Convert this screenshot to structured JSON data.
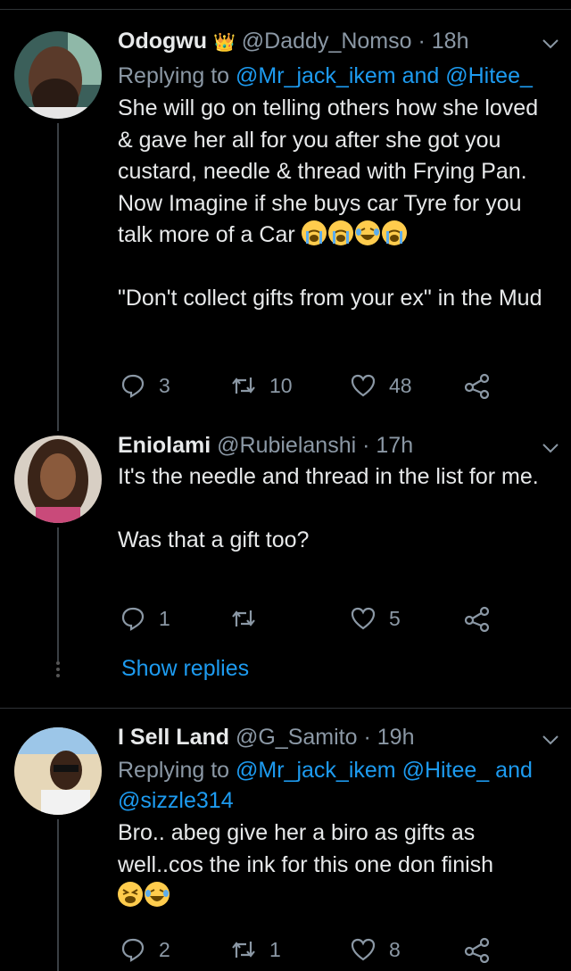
{
  "tweets": [
    {
      "name": "Odogwu",
      "crown": "👑",
      "handle": "@Daddy_Nomso",
      "time": "· 18h",
      "replying_prefix": "Replying to",
      "replying_to": [
        "@Mr_jack_ikem",
        "@Hitee_"
      ],
      "replying_joiner": "and",
      "body": [
        "She will go on telling others how she loved & gave her all for you after she got you custard, needle & thread with Frying Pan. Now Imagine if she buys car Tyre for you talk more of a Car",
        "\"Don't collect gifts from your ex\" in the Mud"
      ],
      "emojis": [
        "crying",
        "crying",
        "laughing",
        "crying"
      ],
      "replies": "3",
      "retweets": "10",
      "likes": "48"
    },
    {
      "name": "Eniolami",
      "handle": "@Rubielanshi",
      "time": "· 17h",
      "body": [
        "It's the needle and thread in the list for me.",
        "Was that a gift too?"
      ],
      "replies": "1",
      "retweets": "",
      "likes": "5",
      "show_replies": "Show replies"
    },
    {
      "name": "I Sell Land",
      "handle": "@G_Samito",
      "time": "· 19h",
      "replying_prefix": "Replying to",
      "replying_to": [
        "@Mr_jack_ikem",
        "@Hitee_",
        "@sizzle314"
      ],
      "replying_joiner": "and",
      "body": [
        "Bro.. abeg give her a biro as gifts as well..cos the ink for this one don finish"
      ],
      "emojis": [
        "tired",
        "laughing"
      ],
      "replies": "2",
      "retweets": "1",
      "likes": "8"
    }
  ],
  "colors": {
    "background": "#000000",
    "accent": "#1d9bf0",
    "muted": "#8b98a5",
    "divider": "#2f3336"
  },
  "icons": [
    "reply-icon",
    "retweet-icon",
    "like-icon",
    "share-icon",
    "chevron-down-icon"
  ]
}
